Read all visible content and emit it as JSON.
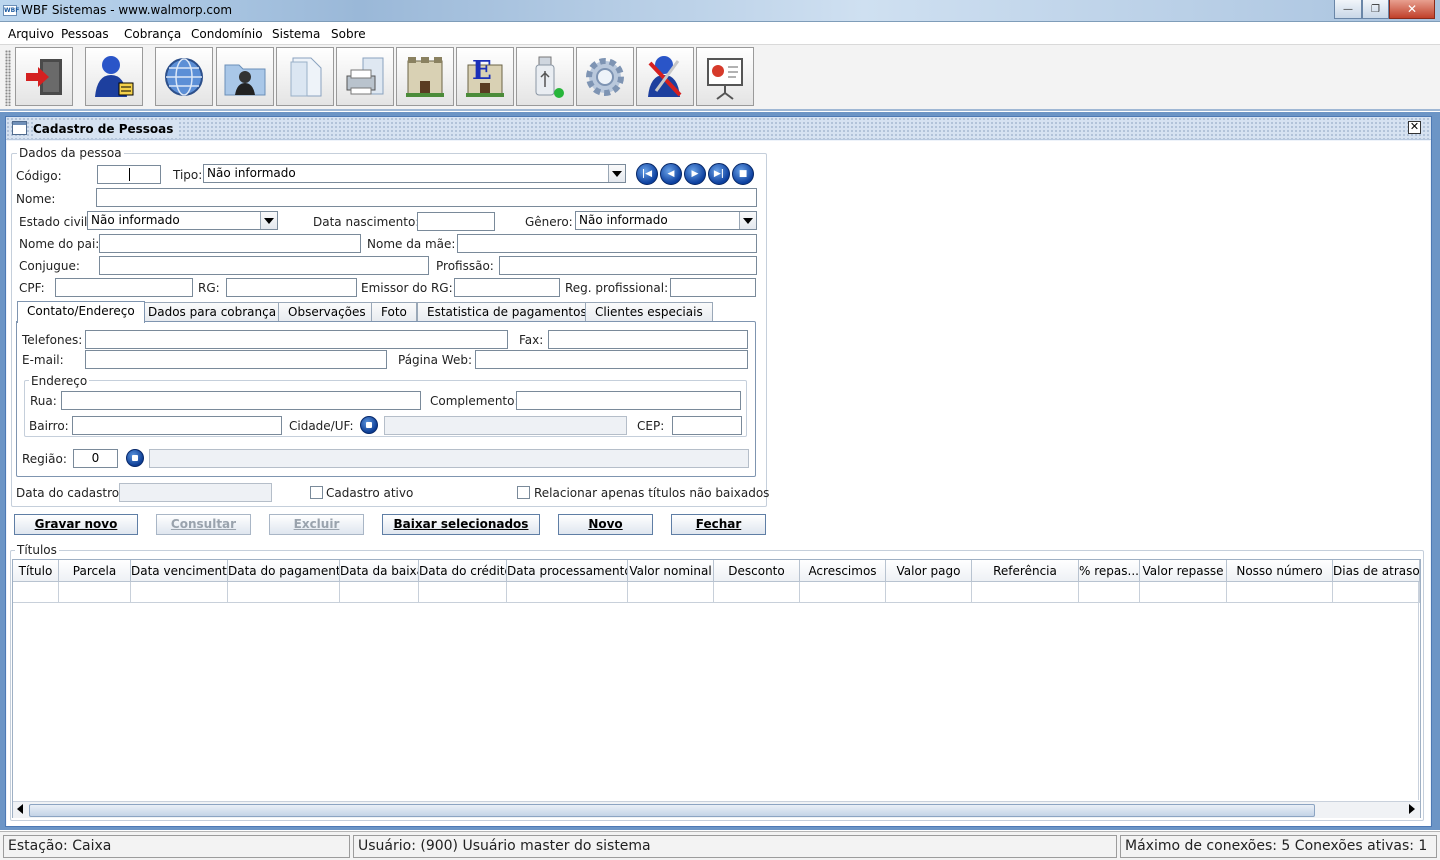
{
  "window": {
    "title": "WBF Sistemas - www.walmorp.com",
    "app_icon_text": "WBF",
    "minimize_symbol": "—",
    "maximize_symbol": "❐",
    "close_symbol": "✕"
  },
  "menu": [
    "Arquivo",
    "Pessoas",
    "Cobrança",
    "Condomínio",
    "Sistema",
    "Sobre"
  ],
  "toolbar": {
    "buttons": [
      "exit-door-icon",
      "user-lock-icon",
      "globe-icon",
      "person-folder-icon",
      "document-icon",
      "printer-icon",
      "building-icon",
      "building-e-icon",
      "usb-drive-icon",
      "gear-icon",
      "user-tools-icon",
      "presentation-icon"
    ]
  },
  "frame": {
    "title": "Cadastro de Pessoas",
    "close_symbol": "✕"
  },
  "person": {
    "group_label": "Dados da pessoa",
    "codigo_label": "Código:",
    "codigo_value": "",
    "tipo_label": "Tipo:",
    "tipo_value": "Não informado",
    "nome_label": "Nome:",
    "nome_value": "",
    "estado_civil_label": "Estado civil:",
    "estado_civil_value": "Não informado",
    "data_nascimento_label": "Data nascimento:",
    "data_nascimento_value": "",
    "genero_label": "Gênero:",
    "genero_value": "Não informado",
    "nome_pai_label": "Nome do pai:",
    "nome_mae_label": "Nome da mãe:",
    "conjugue_label": "Conjugue:",
    "profissao_label": "Profissão:",
    "cpf_label": "CPF:",
    "rg_label": "RG:",
    "emissor_rg_label": "Emissor do RG:",
    "reg_profissional_label": "Reg. profissional:"
  },
  "nav_buttons": [
    "first-record-icon",
    "previous-record-icon",
    "next-record-icon",
    "last-record-icon",
    "stop-icon"
  ],
  "tabs": [
    {
      "label": "Contato/Endereço",
      "active": true
    },
    {
      "label": "Dados para cobrança",
      "active": false
    },
    {
      "label": "Observações",
      "active": false
    },
    {
      "label": "Foto",
      "active": false
    },
    {
      "label": "Estatistica de pagamentos",
      "active": false
    },
    {
      "label": "Clientes especiais",
      "active": false
    }
  ],
  "contact": {
    "telefones_label": "Telefones:",
    "fax_label": "Fax:",
    "email_label": "E-mail:",
    "pagina_web_label": "Página Web:",
    "endereco_group_label": "Endereço",
    "rua_label": "Rua:",
    "complemento_label": "Complemento:",
    "bairro_label": "Bairro:",
    "cidade_uf_label": "Cidade/UF:",
    "cep_label": "CEP:",
    "regiao_label": "Região:",
    "regiao_value": "0"
  },
  "footer_form": {
    "data_cadastro_label": "Data do cadastro:",
    "cadastro_ativo_label": "Cadastro ativo",
    "cadastro_ativo_checked": false,
    "relacionar_label": "Relacionar apenas títulos não baixados",
    "relacionar_checked": false
  },
  "actions": [
    {
      "label": "Gravar novo",
      "enabled": true
    },
    {
      "label": "Consultar",
      "enabled": false
    },
    {
      "label": "Excluir",
      "enabled": false
    },
    {
      "label": "Baixar selecionados",
      "enabled": true
    },
    {
      "label": "Novo",
      "enabled": true
    },
    {
      "label": "Fechar",
      "enabled": true
    }
  ],
  "titulos": {
    "label": "Títulos",
    "columns": [
      "Título",
      "Parcela",
      "Data vencimento",
      "Data do pagamento",
      "Data da baixa",
      "Data do crédito",
      "Data processamento",
      "Valor nominal",
      "Desconto",
      "Acrescimos",
      "Valor pago",
      "Referência",
      "% repas...",
      "Valor repasse",
      "Nosso número",
      "Dias de atraso"
    ],
    "rows": []
  },
  "status": {
    "estacao": "Estação: Caixa",
    "usuario": "Usuário: (900) Usuário master do sistema",
    "conexoes": "Máximo de conexões: 5 Conexões ativas: 1"
  },
  "colors": {
    "desktop": "#6c95c6",
    "nav_button": "#0c3f9e",
    "frame_title": "#d6e2f1"
  }
}
